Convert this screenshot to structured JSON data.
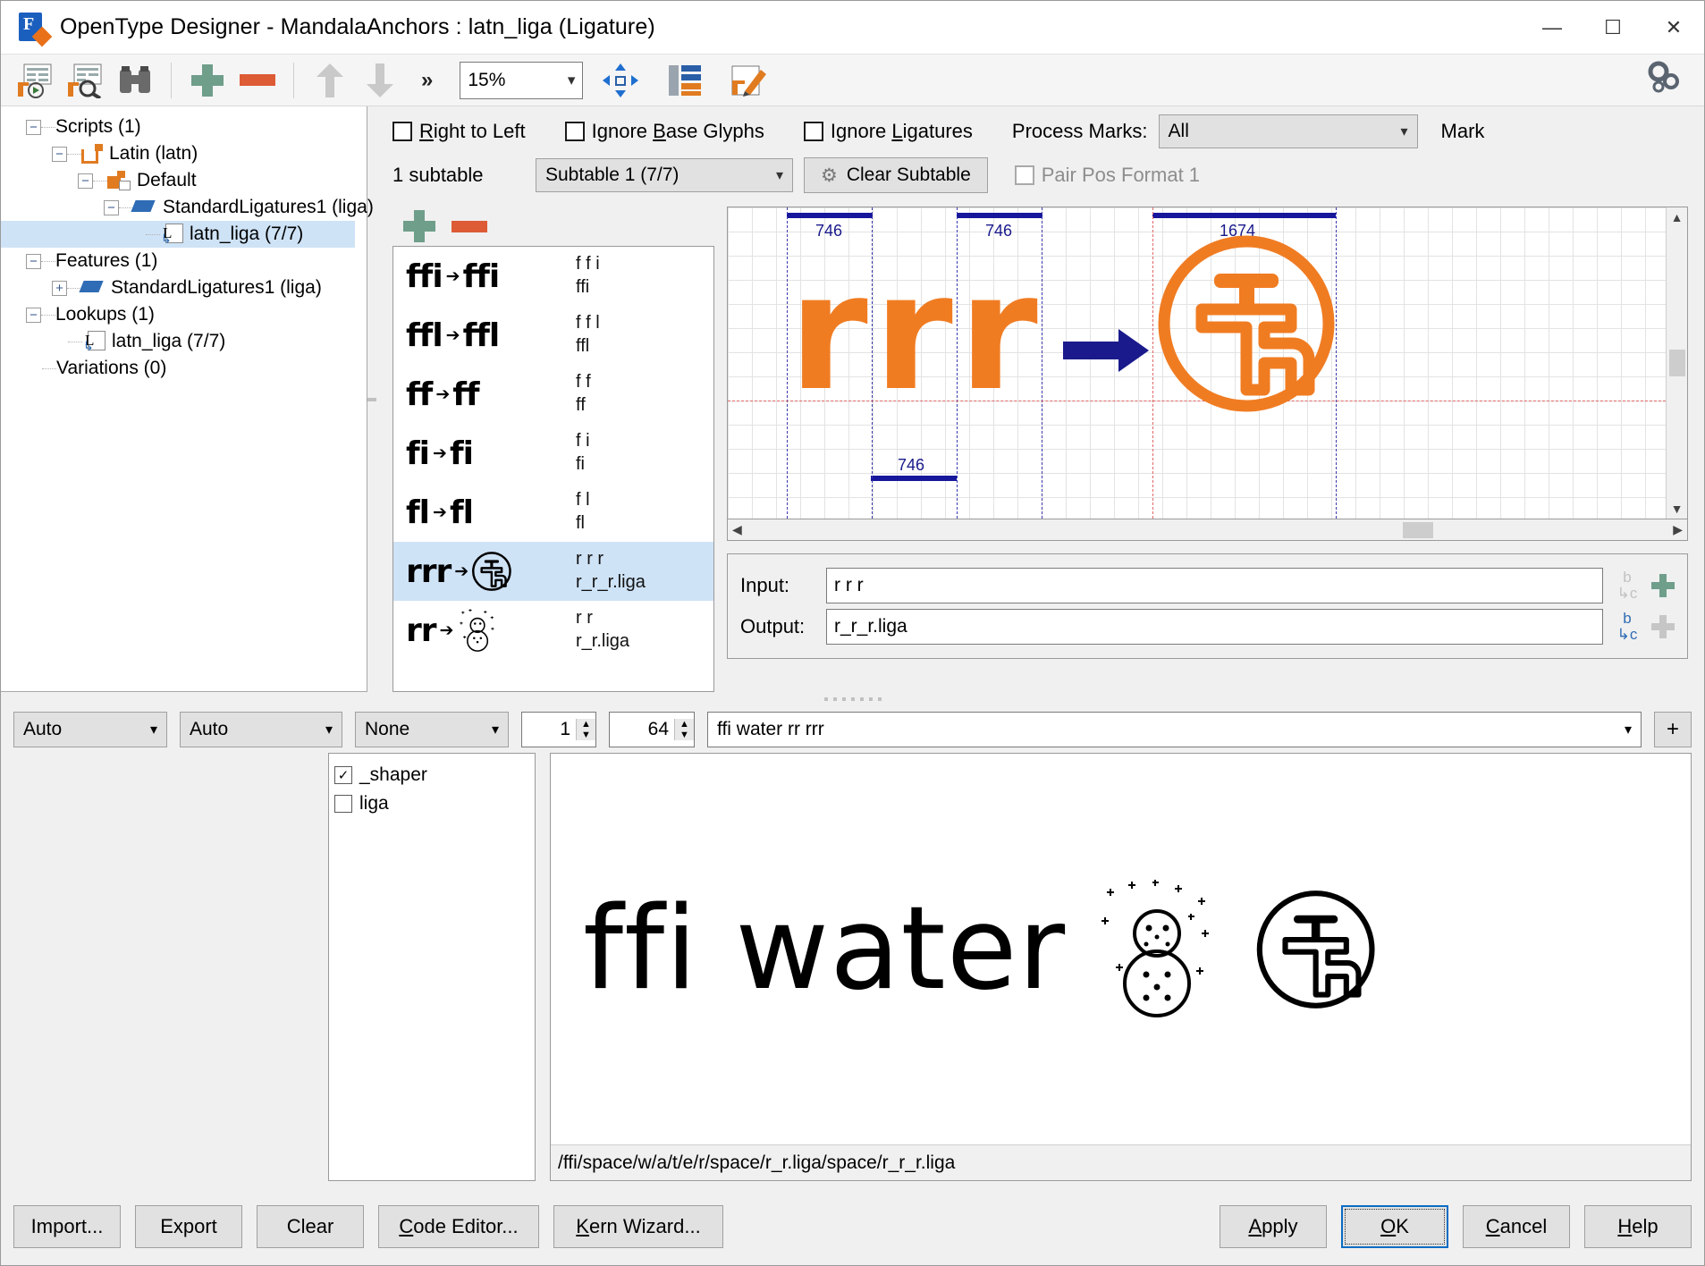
{
  "window": {
    "title": "OpenType Designer - MandalaAnchors : latn_liga (Ligature)",
    "minimize": "—",
    "maximize": "☐",
    "close": "✕"
  },
  "toolbar": {
    "more_label": "»",
    "zoom_value": "15%",
    "chevron": "∨",
    "icons": [
      "preview-run-icon",
      "preview-search-icon",
      "binoculars-icon",
      "add-icon",
      "remove-icon",
      "move-up-icon",
      "move-down-icon",
      "fit-icon",
      "table-icon",
      "edit-icon",
      "settings-gear-icon"
    ]
  },
  "tree": {
    "nodes": [
      {
        "label": "Scripts (1)",
        "toggle": "−",
        "depth": 0,
        "icon": "",
        "selected": false
      },
      {
        "label": "Latin (latn)",
        "toggle": "−",
        "depth": 1,
        "icon": "script-icon",
        "selected": false
      },
      {
        "label": "Default",
        "toggle": "−",
        "depth": 2,
        "icon": "language-icon",
        "selected": false
      },
      {
        "label": "StandardLigatures1 (liga)",
        "toggle": "−",
        "depth": 3,
        "icon": "feature-icon",
        "selected": false
      },
      {
        "label": "latn_liga (7/7)",
        "toggle": "",
        "depth": 4,
        "icon": "lookup-icon",
        "selected": true
      },
      {
        "label": "Features (1)",
        "toggle": "−",
        "depth": 0,
        "icon": "",
        "selected": false
      },
      {
        "label": "StandardLigatures1 (liga)",
        "toggle": "+",
        "depth": 1,
        "icon": "feature-icon",
        "selected": false
      },
      {
        "label": "Lookups (1)",
        "toggle": "−",
        "depth": 0,
        "icon": "",
        "selected": false
      },
      {
        "label": "latn_liga (7/7)",
        "toggle": "",
        "depth": 1,
        "icon": "lookup-icon",
        "selected": false
      },
      {
        "label": "Variations (0)",
        "toggle": "",
        "depth": 0,
        "icon": "",
        "selected": false
      }
    ]
  },
  "options": {
    "right_to_left": {
      "label": "Right to Left",
      "underline_index": 0,
      "checked": false
    },
    "ignore_base_glyphs": {
      "label": "Ignore Base Glyphs",
      "underline_index": 7,
      "checked": false
    },
    "ignore_ligatures": {
      "label": "Ignore Ligatures",
      "underline_index": 7,
      "checked": false
    },
    "process_marks_label": "Process Marks:",
    "process_marks_value": "All",
    "mark_label": "Mark"
  },
  "subtable": {
    "count_label": "1 subtable",
    "selected": "Subtable 1 (7/7)",
    "clear_button": "Clear Subtable",
    "pair_pos_label": "Pair Pos Format 1",
    "pair_pos_checked": false
  },
  "ligature_list": {
    "add_label": "add-ligature",
    "remove_label": "remove-ligature",
    "rows": [
      {
        "glyph_in": "ffi",
        "glyph_out": "ffi",
        "input": "f f i",
        "output": "ffi",
        "selected": false
      },
      {
        "glyph_in": "ffl",
        "glyph_out": "ffl",
        "input": "f f l",
        "output": "ffl",
        "selected": false
      },
      {
        "glyph_in": "ff",
        "glyph_out": "ff",
        "input": "f f",
        "output": "ff",
        "selected": false
      },
      {
        "glyph_in": "fi",
        "glyph_out": "fi",
        "input": "f i",
        "output": "fi",
        "selected": false
      },
      {
        "glyph_in": "fl",
        "glyph_out": "fl",
        "input": "f l",
        "output": "fl",
        "selected": false
      },
      {
        "glyph_in": "rrr",
        "glyph_out": "⚓",
        "input": "r r r",
        "output": "r_r_r.liga",
        "selected": true
      },
      {
        "glyph_in": "rr",
        "glyph_out": "☃",
        "input": "r r",
        "output": "r_r.liga",
        "selected": false
      }
    ]
  },
  "canvas": {
    "measures": [
      "746",
      "746",
      "1674",
      "746"
    ],
    "glyph_letters": [
      "r",
      "r",
      "r"
    ],
    "arrow": "arrow-right",
    "result_icon": "faucet-circle-icon",
    "glyph_color": "#f07c22",
    "measure_color": "#17179c"
  },
  "io": {
    "input_label": "Input:",
    "input_value": "r r r",
    "output_label": "Output:",
    "output_value": "r_r_r.liga"
  },
  "bottom_controls": {
    "combo1": "Auto",
    "combo2": "Auto",
    "combo3": "None",
    "spin1": "1",
    "spin2": "64",
    "sample_text": "ffi water rr rrr",
    "add_button": "+"
  },
  "glyph_features": [
    {
      "label": "_shaper",
      "checked": true
    },
    {
      "label": "liga",
      "checked": false
    }
  ],
  "preview": {
    "text": "ffi water",
    "icons": [
      "snowman-icon",
      "faucet-circle-icon"
    ],
    "status": "/ffi/space/w/a/t/e/r/space/r_r.liga/space/r_r_r.liga"
  },
  "footer": {
    "import": "Import...",
    "export": "Export",
    "clear": "Clear",
    "code_editor": "Code Editor...",
    "kern_wizard": "Kern Wizard...",
    "apply": "Apply",
    "ok": "OK",
    "cancel": "Cancel",
    "help": "Help"
  }
}
